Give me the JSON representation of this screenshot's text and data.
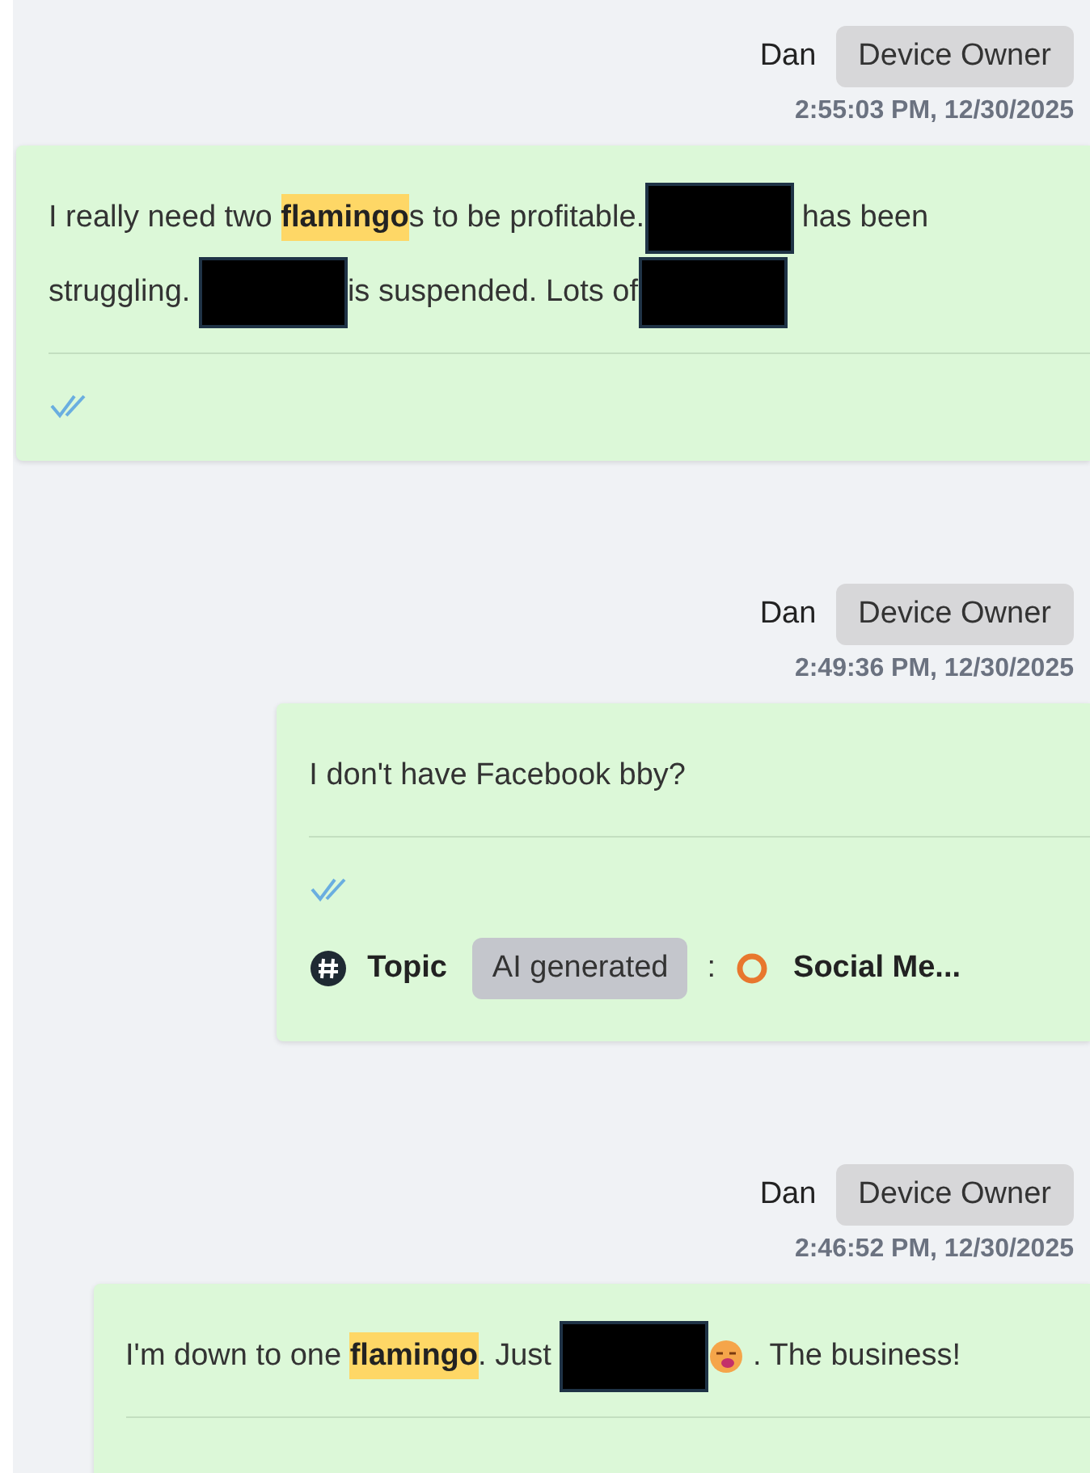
{
  "messages": [
    {
      "sender": "Dan",
      "role": "Device Owner",
      "timestamp": "2:55:03 PM, 12/30/2025",
      "read": true,
      "body": [
        {
          "kind": "text",
          "text": "I really need two "
        },
        {
          "kind": "highlight",
          "text": "flamingo"
        },
        {
          "kind": "text",
          "text": "s to be profitable."
        },
        {
          "kind": "redacted"
        },
        {
          "kind": "text",
          "text": " has been struggling. "
        },
        {
          "kind": "redacted"
        },
        {
          "kind": "text",
          "text": "is suspended. Lots of"
        },
        {
          "kind": "redacted"
        }
      ]
    },
    {
      "sender": "Dan",
      "role": "Device Owner",
      "timestamp": "2:49:36 PM, 12/30/2025",
      "read": true,
      "body": [
        {
          "kind": "text",
          "text": "I don't have Facebook bby?"
        }
      ],
      "topic": {
        "label": "Topic",
        "tag": "AI generated",
        "separator": ":",
        "value": "Social Me..."
      }
    },
    {
      "sender": "Dan",
      "role": "Device Owner",
      "timestamp": "2:46:52 PM, 12/30/2025",
      "body": [
        {
          "kind": "text",
          "text": "I'm down to one "
        },
        {
          "kind": "highlight",
          "text": "flamingo"
        },
        {
          "kind": "text",
          "text": ". Just "
        },
        {
          "kind": "redacted"
        },
        {
          "kind": "emoji"
        },
        {
          "kind": "text",
          "text": " . The business!"
        }
      ]
    }
  ]
}
